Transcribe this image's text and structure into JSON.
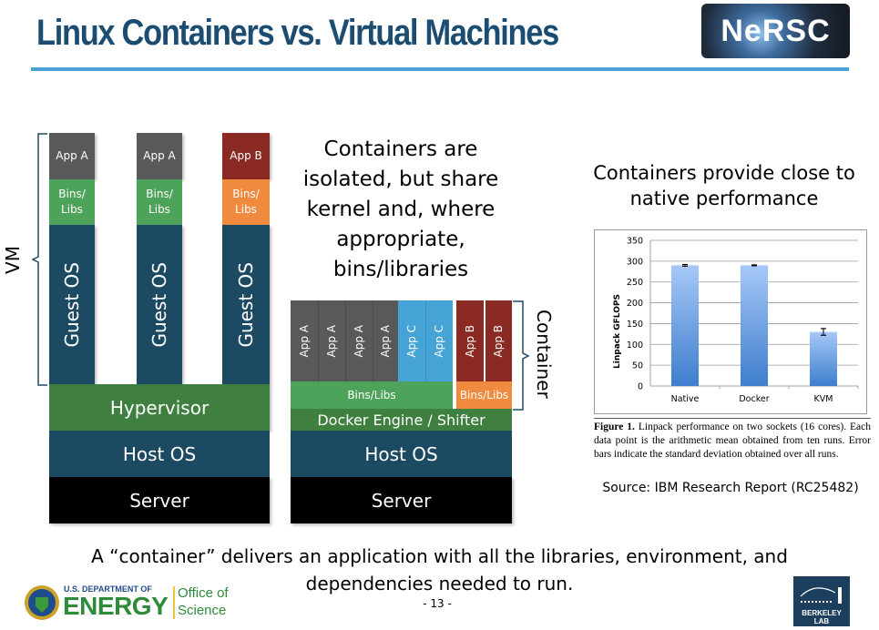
{
  "slide": {
    "title": "Linux Containers vs. Virtual Machines",
    "logo_text": "NeRSC",
    "page_number": "- 13 -",
    "bottom_text": "A “container” delivers an application with all the libraries, environment, and dependencies needed to run."
  },
  "vm_diagram": {
    "bracket_label": "VM",
    "columns": [
      {
        "app": "App A",
        "bins": "Bins/ Libs",
        "guest": "Guest OS"
      },
      {
        "app": "App A",
        "bins": "Bins/ Libs",
        "guest": "Guest OS"
      },
      {
        "app": "App B",
        "bins": "Bins/ Libs",
        "guest": "Guest OS"
      }
    ],
    "hypervisor": "Hypervisor",
    "host_os": "Host OS",
    "server": "Server"
  },
  "container_diagram": {
    "bracket_label": "Container",
    "apps": [
      "App A",
      "App A",
      "App A",
      "App A",
      "App C",
      "App C",
      "App B",
      "App B"
    ],
    "bins_shared": "Bins/Libs",
    "bins_b": "Bins/Libs",
    "engine": "Docker Engine / Shifter",
    "host_os": "Host OS",
    "server": "Server"
  },
  "center_text": "Containers are isolated, but share kernel and, where appropriate, bins/libraries",
  "perf_heading": "Containers provide close to native performance",
  "figure_caption": {
    "label": "Figure 1.",
    "text": " Linpack performance on two sockets (16 cores). Each data point is the arithmetic mean obtained from ten runs. Error bars indicate the standard deviation obtained over all runs."
  },
  "source": "Source: IBM Research Report (RC25482)",
  "footer": {
    "doe_line1": "U.S. DEPARTMENT OF",
    "doe_line2": "ENERGY",
    "office_line1": "Office of",
    "office_line2": "Science",
    "berkeley": "BERKELEY LAB"
  },
  "colors": {
    "title": "#1b4c72",
    "app_gray": "#595959",
    "app_red": "#8b2a22",
    "app_blue": "#46a3d6",
    "bins_green": "#4da35a",
    "bins_orange": "#f08a3e",
    "os_navy": "#1d4a63",
    "hypervisor_green": "#3f7f3f",
    "bar_blue": "#5a9ae6"
  },
  "chart_data": {
    "type": "bar",
    "title": "",
    "xlabel": "",
    "ylabel": "Linpack GFLOPS",
    "categories": [
      "Native",
      "Docker",
      "KVM"
    ],
    "values": [
      290,
      290,
      130
    ],
    "error": [
      2,
      1,
      8
    ],
    "ylim": [
      0,
      350
    ],
    "yticks": [
      0,
      50,
      100,
      150,
      200,
      250,
      300,
      350
    ],
    "grid": true,
    "legend": "none"
  }
}
